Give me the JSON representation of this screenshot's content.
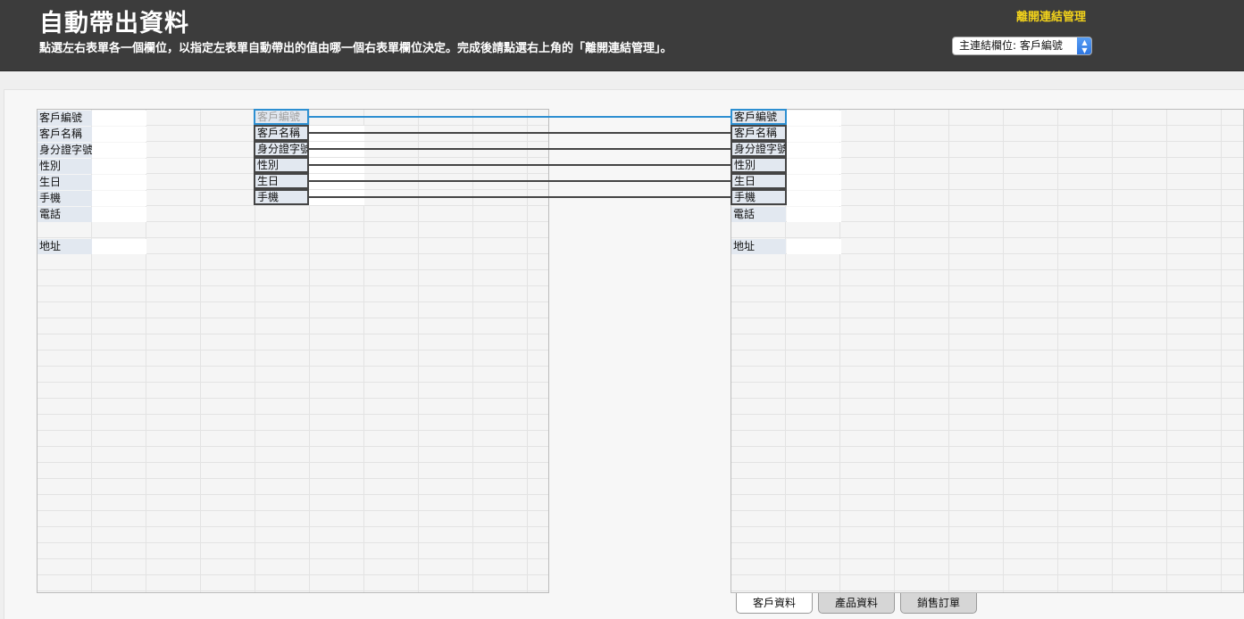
{
  "header": {
    "title": "自動帶出資料",
    "description": "點選左右表單各一個欄位，以指定左表單自動帶出的值由哪一個右表單欄位決定。完成後請點選右上角的「離開連結管理」。",
    "exit_label": "離開連結管理",
    "master_select": {
      "value": "主連結欄位: 客戶編號"
    }
  },
  "left_form": {
    "fields": [
      "客戶編號",
      "客戶名稱",
      "身分證字號",
      "性別",
      "生日",
      "手機",
      "電話",
      "地址"
    ]
  },
  "linked_fields": {
    "left": [
      "客戶編號",
      "客戶名稱",
      "身分證字號",
      "性別",
      "生日",
      "手機"
    ],
    "right": [
      "客戶編號",
      "客戶名稱",
      "身分證字號",
      "性別",
      "生日",
      "手機"
    ]
  },
  "right_form": {
    "fields": [
      "客戶編號",
      "客戶名稱",
      "身分證字號",
      "性別",
      "生日",
      "手機",
      "電話",
      "地址"
    ]
  },
  "tabs": [
    {
      "label": "客戶資料",
      "active": true
    },
    {
      "label": "產品資料",
      "active": false
    },
    {
      "label": "銷售訂單",
      "active": false
    }
  ],
  "colors": {
    "header_bg": "#3c3c3c",
    "exit_link": "#f2d21b",
    "active_link": "#2d8fd1",
    "link_line": "#444444",
    "label_bg": "#e2e8f0"
  }
}
